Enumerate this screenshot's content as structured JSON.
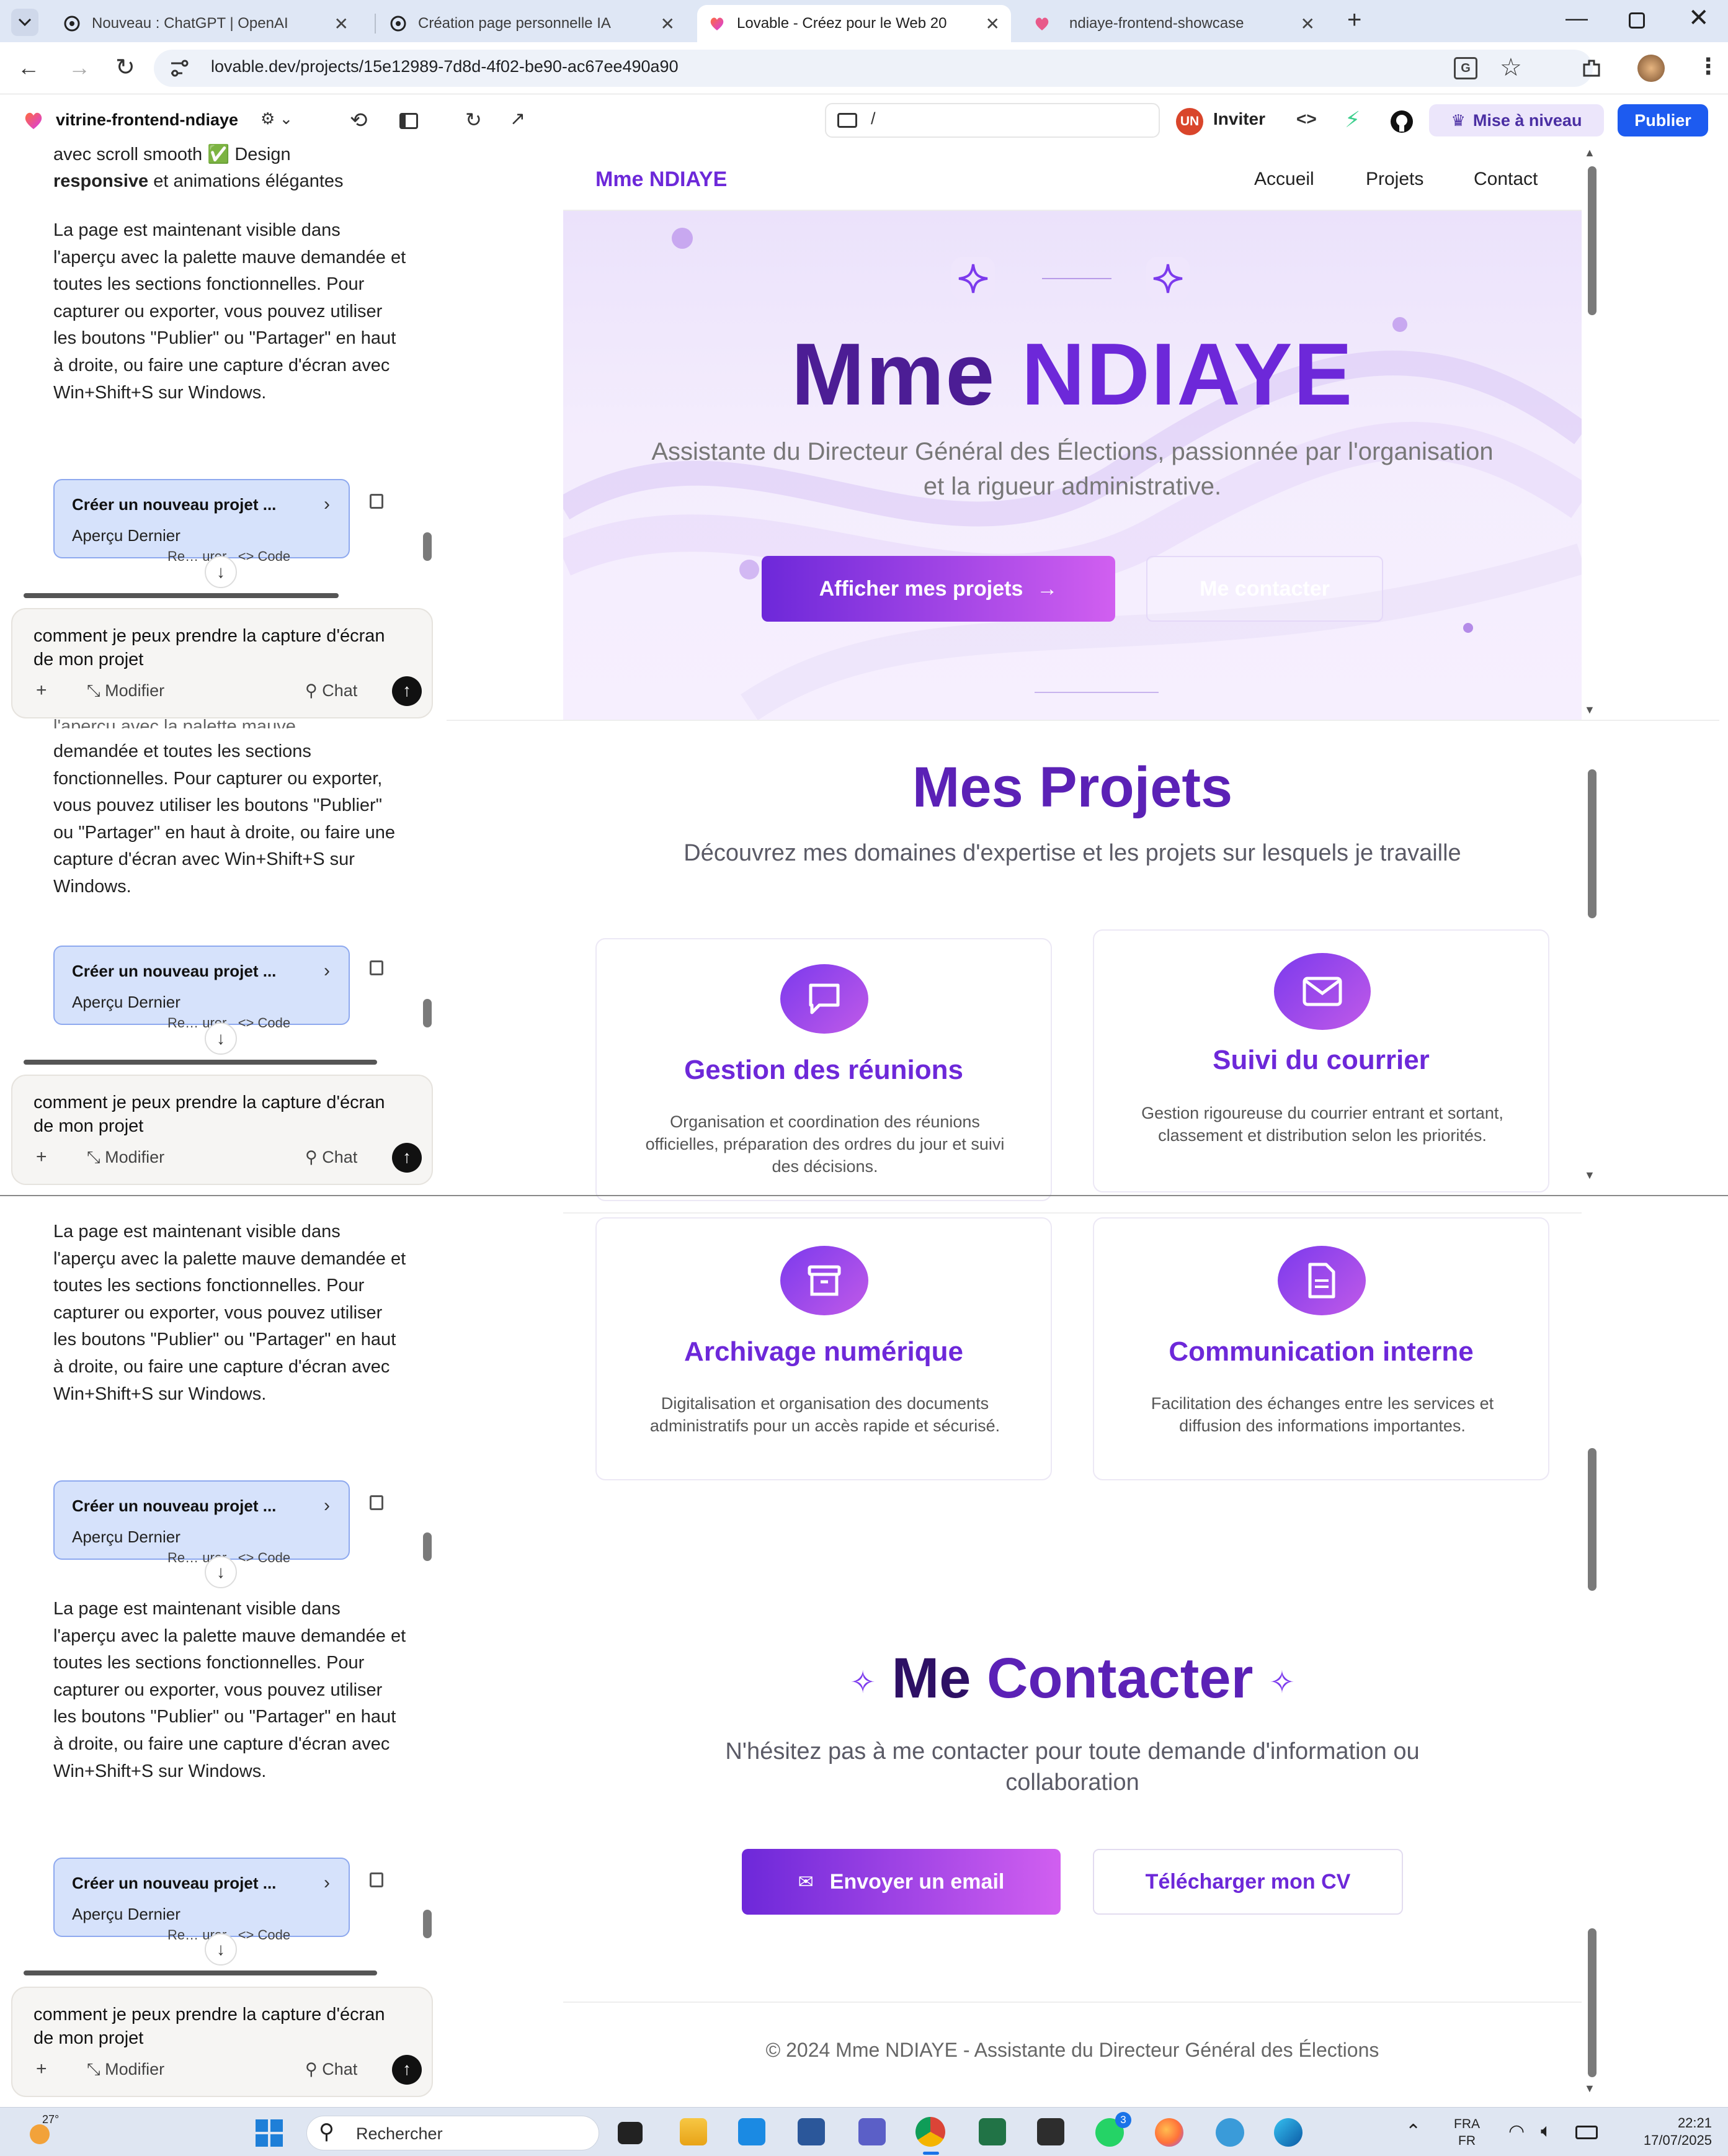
{
  "browser": {
    "tabs": [
      {
        "title": "Nouveau : ChatGPT | OpenAI"
      },
      {
        "title": "Création page personnelle IA"
      },
      {
        "title": "Lovable - Créez pour le Web 20"
      },
      {
        "title": "ndiaye-frontend-showcase"
      }
    ],
    "url": "lovable.dev/projects/15e12989-7d8d-4f02-be90-ac67ee490a90"
  },
  "lovable": {
    "project_name": "vitrine-frontend-ndiaye",
    "path": "/",
    "avatar_initials": "UN",
    "invite": "Inviter",
    "upgrade": "Mise à niveau",
    "publish": "Publier"
  },
  "chat": {
    "top_snippet_1": "avec scroll smooth ✅ Design",
    "top_snippet_2a": "responsive",
    "top_snippet_2b": " et animations élégantes",
    "message": "La page est maintenant visible dans l'aperçu avec la palette mauve demandée et toutes les sections fonctionnelles. Pour capturer ou exporter, vous pouvez utiliser les boutons \"Publier\" ou \"Partager\" en haut à droite, ou faire une capture d'écran avec Win+Shift+S sur Windows.",
    "message_cut": "l'aperçu avec la palette mauve",
    "message_rest": "demandée et toutes les sections fonctionnelles. Pour capturer ou exporter, vous pouvez utiliser les boutons \"Publier\" ou \"Partager\" en haut à droite, ou faire une capture d'écran avec Win+Shift+S sur Windows.",
    "card_title": "Créer un nouveau projet ...",
    "card_sub": "Aperçu Dernier",
    "restore": "Re… urer",
    "code": "Code",
    "question": "comment je peux prendre la capture d'écran de mon projet",
    "modify": "Modifier",
    "chat_label": "Chat"
  },
  "site": {
    "brand": "Mme NDIAYE",
    "nav": [
      "Accueil",
      "Projets",
      "Contact"
    ],
    "hero_title_1": "Mme",
    "hero_title_2": "NDIAYE",
    "hero_sub": "Assistante du Directeur Général des Élections, passionnée par l'organisation et la rigueur administrative.",
    "btn_projects": "Afficher mes projets",
    "btn_contact": "Me contacter",
    "projects_title": "Mes Projets",
    "projects_sub": "Découvrez mes domaines d'expertise et les projets sur lesquels je travaille",
    "projects": [
      {
        "title": "Gestion des réunions",
        "desc": "Organisation et coordination des réunions officielles, préparation des ordres du jour et suivi des décisions.",
        "icon": "message-icon"
      },
      {
        "title": "Suivi du courrier",
        "desc": "Gestion rigoureuse du courrier entrant et sortant, classement et distribution selon les priorités.",
        "icon": "mail-icon"
      },
      {
        "title": "Archivage numérique",
        "desc": "Digitalisation et organisation des documents administratifs pour un accès rapide et sécurisé.",
        "icon": "archive-icon"
      },
      {
        "title": "Communication interne",
        "desc": "Facilitation des échanges entre les services et diffusion des informations importantes.",
        "icon": "document-icon"
      }
    ],
    "contact_title_1": "Me",
    "contact_title_2": "Contacter",
    "contact_sub": "N'hésitez pas à me contacter pour toute demande d'information ou collaboration",
    "btn_email": "Envoyer un email",
    "btn_cv": "Télécharger mon CV",
    "footer": "© 2024 Mme NDIAYE - Assistante du Directeur Général des Élections"
  },
  "taskbar": {
    "weather": "27°",
    "search": "Rechercher",
    "lang_1": "FRA",
    "lang_2": "FR",
    "time": "22:21",
    "date": "17/07/2025",
    "whatsapp_badge": "3"
  },
  "colors": {
    "accent": "#6d28d9",
    "accent_light": "#c05ae8",
    "lovable_blue": "#1d5bf0"
  }
}
